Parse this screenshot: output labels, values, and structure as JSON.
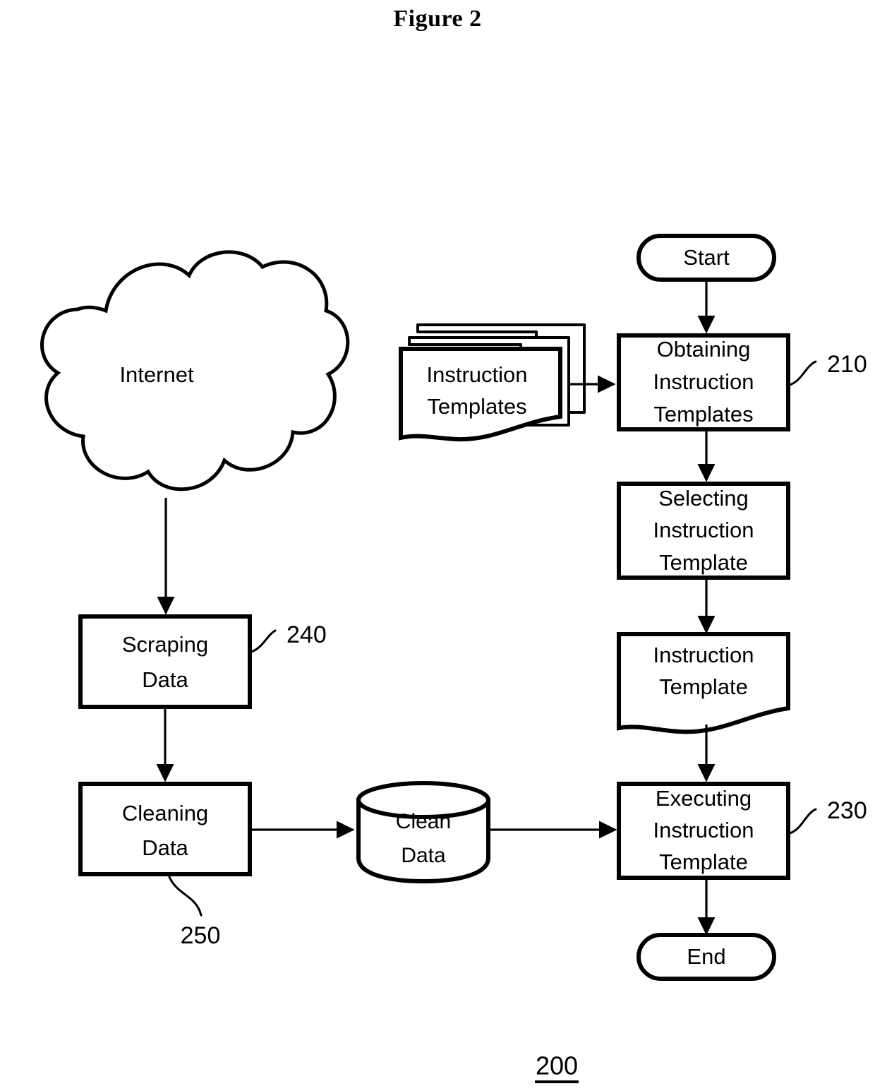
{
  "figure": {
    "title": "Figure 2",
    "caption": "200"
  },
  "nodes": {
    "start": {
      "label": "Start",
      "shape": "terminator"
    },
    "end": {
      "label": "End",
      "shape": "terminator"
    },
    "instruction_templates_source": {
      "line1": "Instruction",
      "line2": "Templates",
      "shape": "multi-document"
    },
    "obtaining": {
      "line1": "Obtaining",
      "line2": "Instruction",
      "line3": "Templates",
      "shape": "process",
      "ref": "210"
    },
    "selecting": {
      "line1": "Selecting",
      "line2": "Instruction",
      "line3": "Template",
      "shape": "process"
    },
    "instruction_template_doc": {
      "line1": "Instruction",
      "line2": "Template",
      "shape": "document"
    },
    "executing": {
      "line1": "Executing",
      "line2": "Instruction",
      "line3": "Template",
      "shape": "process",
      "ref": "230"
    },
    "internet": {
      "label": "Internet",
      "shape": "cloud"
    },
    "scraping": {
      "line1": "Scraping",
      "line2": "Data",
      "shape": "process",
      "ref": "240"
    },
    "cleaning": {
      "line1": "Cleaning",
      "line2": "Data",
      "shape": "process",
      "ref": "250"
    },
    "clean_data_store": {
      "line1": "Clean",
      "line2": "Data",
      "shape": "database"
    }
  },
  "colors": {
    "stroke": "#000000",
    "fill": "#ffffff"
  }
}
